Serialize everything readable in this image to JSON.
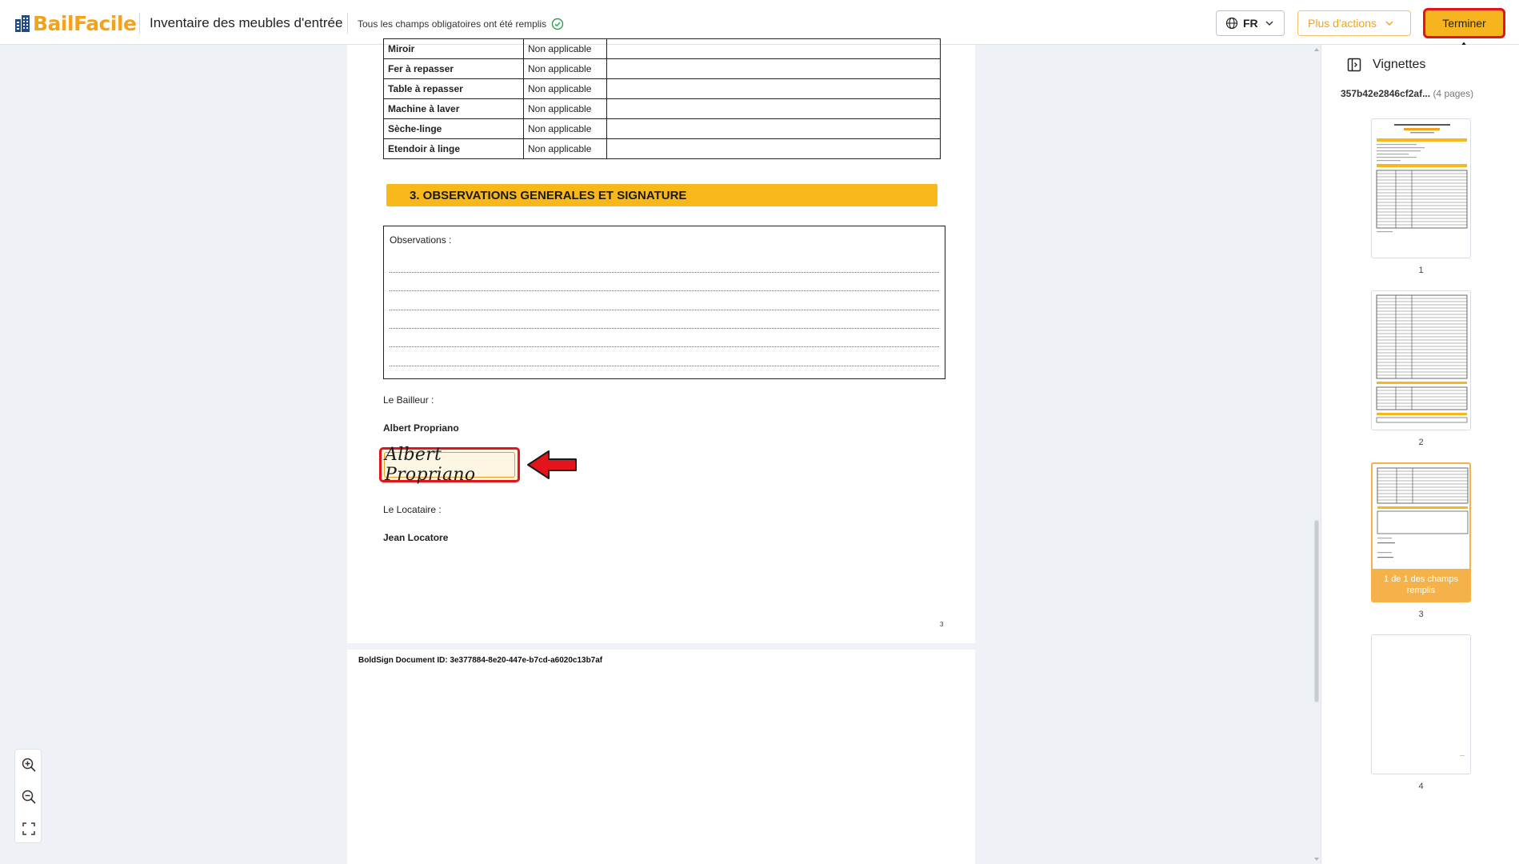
{
  "header": {
    "logo_part1": "Bail",
    "logo_part2": "Facile",
    "doc_title": "Inventaire des meubles d'entrée",
    "status_text": "Tous les champs obligatoires ont été remplis",
    "lang_label": "FR",
    "actions_label": "Plus d'actions",
    "finish_label": "Terminer"
  },
  "document": {
    "items": [
      {
        "name": "Miroir",
        "value": "Non applicable",
        "observation": ""
      },
      {
        "name": "Fer à repasser",
        "value": "Non applicable",
        "observation": ""
      },
      {
        "name": "Table à repasser",
        "value": "Non applicable",
        "observation": ""
      },
      {
        "name": "Machine à laver",
        "value": "Non applicable",
        "observation": ""
      },
      {
        "name": "Sèche-linge",
        "value": "Non applicable",
        "observation": ""
      },
      {
        "name": "Etendoir à linge",
        "value": "Non applicable",
        "observation": ""
      }
    ],
    "section_title": "3. OBSERVATIONS GENERALES ET SIGNATURE",
    "observations_label": "Observations :",
    "landlord_label": "Le Bailleur :",
    "landlord_name": "Albert Propriano",
    "signature_text": "Albert Propriano",
    "tenant_label": "Le Locataire :",
    "tenant_name": "Jean Locatore",
    "page_number": "3",
    "boldsign_id": "BoldSign Document ID: 3e377884-8e20-447e-b7cd-a6020c13b7af"
  },
  "panel": {
    "title": "Vignettes",
    "file_name": "357b42e2846cf2af...",
    "page_count": "(4 pages)",
    "thumbnails": [
      {
        "number": "1"
      },
      {
        "number": "2"
      },
      {
        "number": "3",
        "overlay": "1 de 1 des champs remplis"
      },
      {
        "number": "4"
      }
    ]
  },
  "colors": {
    "accent": "#f4a21a",
    "section_bar": "#f8b81a",
    "highlight_red": "#e3141b",
    "finish_button": "#f6b51e",
    "success_green": "#2e9e4f"
  },
  "icons": [
    "building-icon",
    "check-circle-icon",
    "globe-icon",
    "chevron-down-icon",
    "panel-icon",
    "zoom-in-icon",
    "zoom-out-icon",
    "fullscreen-icon"
  ]
}
